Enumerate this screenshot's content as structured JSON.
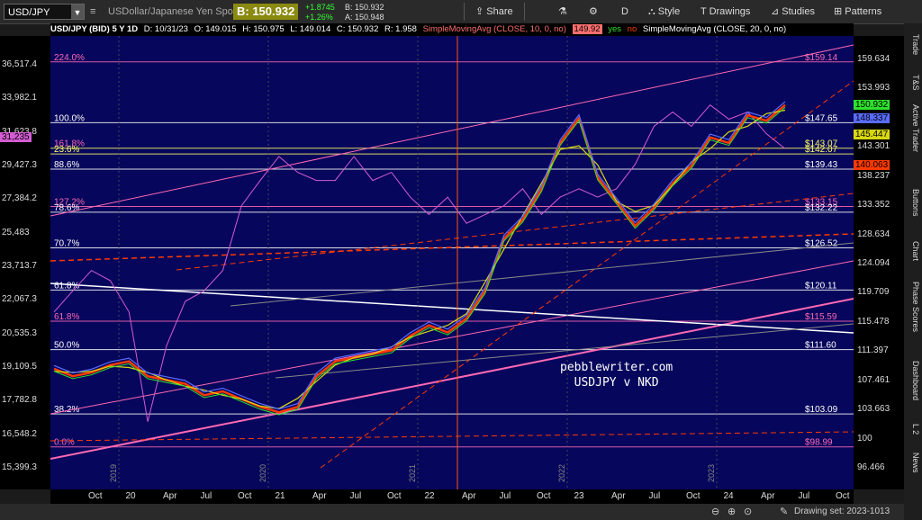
{
  "toolbar": {
    "symbol": "USD/JPY",
    "description": "USDollar/Japanese Yen Spot",
    "bid_label": "B: 150.932",
    "change_abs": "+1.8745",
    "change_pct": "+1.26%",
    "bid_small": "B: 150.932",
    "ask_small": "A: 150.948",
    "share": "Share",
    "period": "D",
    "style": "Style",
    "drawings": "Drawings",
    "studies": "Studies",
    "patterns": "Patterns"
  },
  "infobar": {
    "title": "USD/JPY (BID) 5 Y 1D",
    "date": "D: 10/31/23",
    "open": "O: 149.015",
    "high": "H: 150.975",
    "low": "L: 149.014",
    "close": "C: 150.932",
    "range": "R: 1.958",
    "sma10": "SimpleMovingAvg (CLOSE, 10, 0, no)",
    "sma10_val": "149.92",
    "yes": "yes",
    "no": "no",
    "sma20": "SimpleMovingAvg (CLOSE, 20, 0, no)"
  },
  "sidebar": [
    "Trade",
    "T&S",
    "Active Trader",
    "Buttons",
    "Chart",
    "Phase Scores",
    "Dashboard",
    "L 2",
    "News"
  ],
  "bottombar": {
    "drawing_set": "Drawing set: 2023-1013"
  },
  "colors": {
    "plot_bg": "#06065c",
    "sma10": "#ff6f6f",
    "sma20": "#2222ff",
    "price": "#d45cd4",
    "fib": "#ff69b4",
    "ma_long": "#ff3a00"
  },
  "chart_data": {
    "type": "line",
    "annotation": "pebblewriter.com\nUSDJPY v NKD",
    "left_axis": {
      "ticks": [
        "36,517.4",
        "33,982.1",
        "31,623.8",
        "29,427.3",
        "27,384.2",
        "25,483",
        "23,713.7",
        "22,067.3",
        "20,535.3",
        "19,109.5",
        "17,782.8",
        "16,548.2",
        "15,399.3"
      ],
      "highlight": "31,235"
    },
    "right_axis": {
      "ticks": [
        "159.634",
        "153.993",
        "148.553",
        "143.301",
        "138.237",
        "133.352",
        "128.634",
        "124.094",
        "119.709",
        "115.478",
        "111.397",
        "107.461",
        "103.663",
        "100",
        "96.466"
      ]
    },
    "price_tags": [
      {
        "label": "150.932",
        "color": "#2ee12e"
      },
      {
        "label": "148.337",
        "color": "#5a6cff"
      },
      {
        "label": "145.447",
        "color": "#d8d810"
      },
      {
        "label": "140.063",
        "color": "#ff3a00"
      }
    ],
    "fib_levels_left": [
      {
        "label": "224.0%",
        "color": "#ff69b4"
      },
      {
        "label": "100.0%",
        "color": "#ffffff"
      },
      {
        "label": "161.8%",
        "color": "#ff69b4"
      },
      {
        "label": "23.6%",
        "color": "#ffff66"
      },
      {
        "label": "88.6%",
        "color": "#ffffff"
      },
      {
        "label": "127.2%",
        "color": "#ff69b4"
      },
      {
        "label": "78.6%",
        "color": "#ffffff"
      },
      {
        "label": "70.7%",
        "color": "#ffffff"
      },
      {
        "label": "61.8%",
        "color": "#ffffff"
      },
      {
        "label": "61.8%",
        "color": "#ff69b4"
      },
      {
        "label": "50.0%",
        "color": "#ffffff"
      },
      {
        "label": "38.2%",
        "color": "#ffffff"
      },
      {
        "label": "0.0%",
        "color": "#ff69b4"
      }
    ],
    "fib_levels_right": [
      {
        "label": "$159.14",
        "color": "#ff69b4"
      },
      {
        "label": "$147.65",
        "color": "#ffffff"
      },
      {
        "label": "$143.07",
        "color": "#ffff66"
      },
      {
        "label": "$142.07",
        "color": "#ffff66"
      },
      {
        "label": "$139.43",
        "color": "#ffffff"
      },
      {
        "label": "$133.15",
        "color": "#ff69b4"
      },
      {
        "label": "$132.22",
        "color": "#ffffff"
      },
      {
        "label": "$126.52",
        "color": "#ffffff"
      },
      {
        "label": "$120.11",
        "color": "#ffffff"
      },
      {
        "label": "$115.59",
        "color": "#ff69b4"
      },
      {
        "label": "$111.60",
        "color": "#ffffff"
      },
      {
        "label": "$103.09",
        "color": "#ffffff"
      },
      {
        "label": "$98.99",
        "color": "#ff69b4"
      }
    ],
    "year_markers": [
      "2019",
      "2020",
      "2021",
      "2022",
      "2023"
    ],
    "x_ticks": [
      "Oct",
      "20",
      "Apr",
      "Jul",
      "Oct",
      "21",
      "Apr",
      "Jul",
      "Oct",
      "22",
      "Apr",
      "Jul",
      "Oct",
      "23",
      "Apr",
      "Jul",
      "Oct",
      "24",
      "Apr",
      "Jul",
      "Oct"
    ],
    "usdjpy_series": [
      109,
      108,
      108.5,
      109.5,
      110,
      108,
      107.5,
      107,
      105.5,
      106,
      105,
      104,
      103.3,
      104,
      108,
      110,
      110.5,
      111,
      111.5,
      113.5,
      115,
      114,
      116,
      120,
      128,
      131,
      136,
      144,
      148.5,
      138,
      134,
      130,
      133,
      137,
      140,
      145,
      144,
      149,
      148,
      150.9
    ],
    "nkd_series": [
      21500,
      22500,
      23500,
      23000,
      21500,
      17000,
      20000,
      22000,
      22500,
      23500,
      27000,
      28500,
      30000,
      29000,
      28500,
      28500,
      30000,
      28500,
      29000,
      27500,
      26500,
      27500,
      26000,
      26500,
      27000,
      28000,
      26500,
      27500,
      28000,
      27500,
      28000,
      29500,
      32000,
      33000,
      32000,
      33500,
      32500,
      33000,
      31500,
      30500
    ]
  }
}
